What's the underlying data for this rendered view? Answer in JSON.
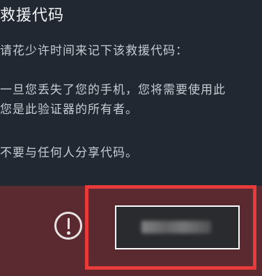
{
  "dialog": {
    "title": "救援代码",
    "instruction": "请花少许时间来记下该救援代码：",
    "explanation_line1": "一旦您丢失了您的手机，您将需要使用此",
    "explanation_line2": "您是此验证器的所有者。",
    "warning": "不要与任何人分享代码。"
  },
  "code_panel": {
    "warning_icon": "exclamation-circle-icon",
    "code_value": "",
    "code_obscured": true
  },
  "colors": {
    "background": "#212832",
    "code_band": "#5a2a30",
    "highlight_frame": "#e8393b",
    "code_box_border": "#ffffff"
  }
}
